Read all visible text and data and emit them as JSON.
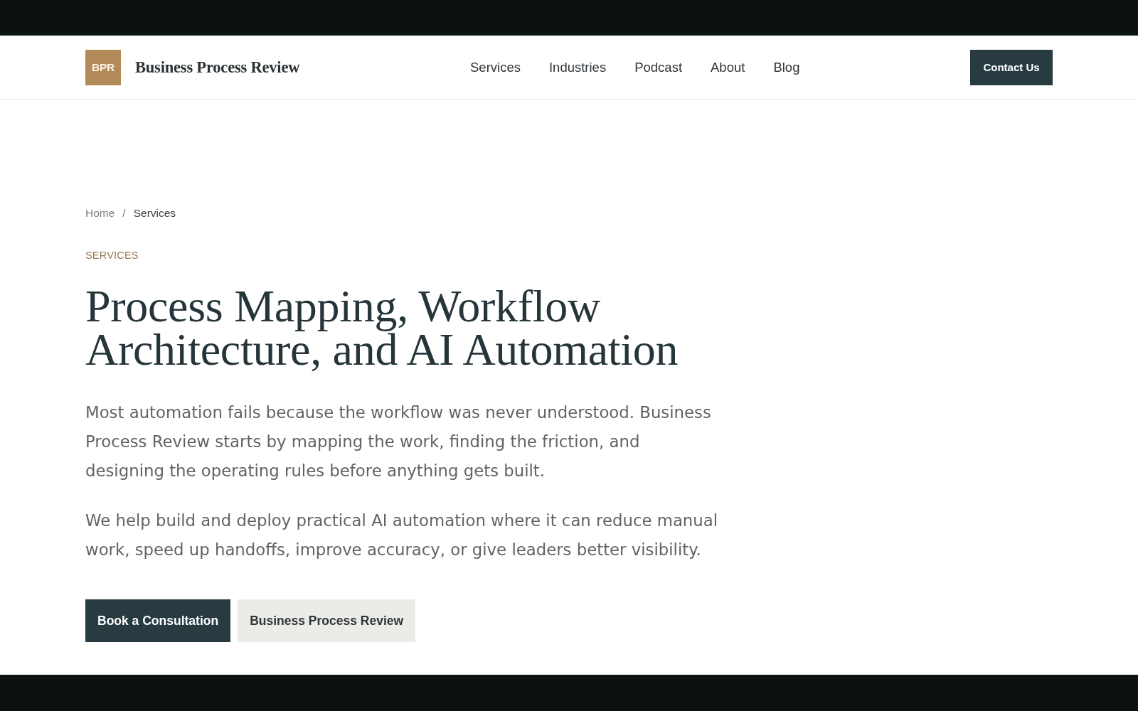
{
  "header": {
    "logo": {
      "mark": "BPR",
      "name": "Business Process Review"
    },
    "nav": [
      {
        "label": "Services"
      },
      {
        "label": "Industries"
      },
      {
        "label": "Podcast"
      },
      {
        "label": "About"
      },
      {
        "label": "Blog"
      }
    ],
    "cta": "Contact Us"
  },
  "breadcrumb": {
    "separator": "/",
    "items": [
      {
        "label": "Home",
        "current": false
      },
      {
        "label": "Services",
        "current": true
      }
    ]
  },
  "hero": {
    "eyebrow": "SERVICES",
    "title": "Process Mapping, Workflow Architecture, and AI Automation",
    "paragraphs": [
      "Most automation fails because the workflow was never understood. Business Process Review starts by mapping the work, finding the friction, and designing the operating rules before anything gets built.",
      "We help build and deploy practical AI automation where it can reduce manual work, speed up handoffs, improve accuracy, or give leaders better visibility."
    ],
    "buttons": [
      {
        "label": "Book a Consultation",
        "kind": "primary"
      },
      {
        "label": "Business Process Review",
        "kind": "secondary"
      }
    ]
  }
}
